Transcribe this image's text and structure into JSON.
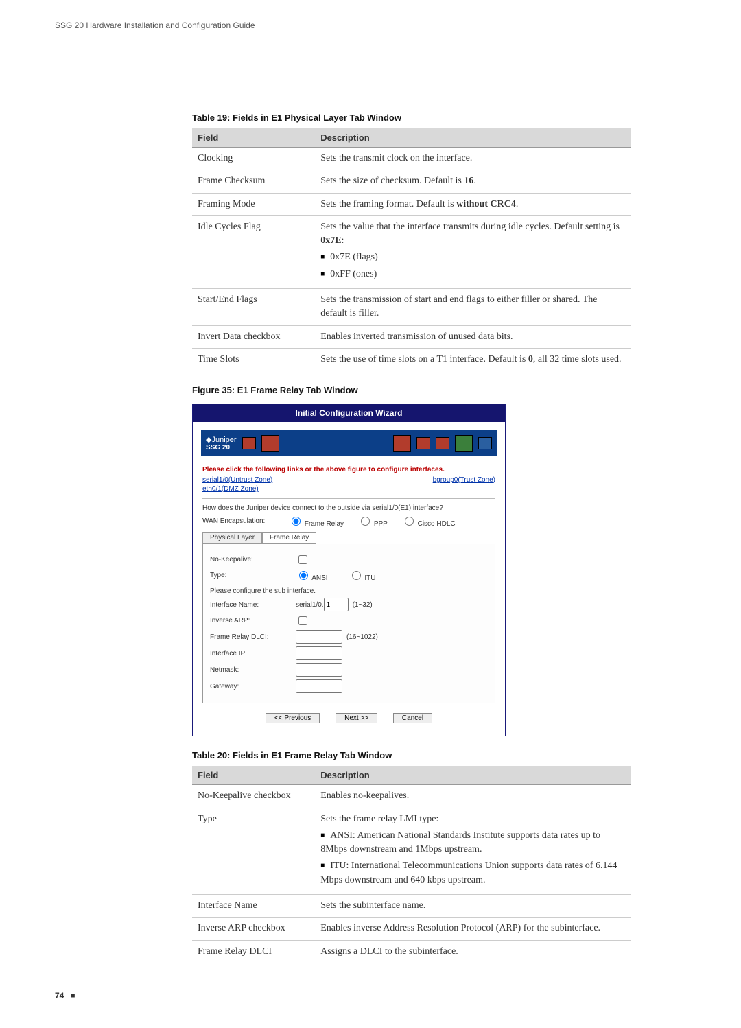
{
  "header": "SSG 20 Hardware Installation and Configuration Guide",
  "page_number": "74",
  "table19": {
    "caption": "Table 19:  Fields in E1 Physical Layer Tab Window",
    "head_field": "Field",
    "head_desc": "Description",
    "r0f": "Clocking",
    "r0d": "Sets the transmit clock on the interface.",
    "r1f": "Frame Checksum",
    "r1d_a": "Sets the size of checksum. Default is ",
    "r1d_b": "16",
    "r1d_c": ".",
    "r2f": "Framing Mode",
    "r2d_a": "Sets the framing format. Default is ",
    "r2d_b": "without CRC4",
    "r2d_c": ".",
    "r3f": "Idle Cycles Flag",
    "r3d_a": "Sets the value that the interface transmits during idle cycles. Default setting is ",
    "r3d_b": "0x7E",
    "r3d_c": ":",
    "r3li1": "0x7E (flags)",
    "r3li2": "0xFF (ones)",
    "r4f": "Start/End Flags",
    "r4d": "Sets the transmission of start and end flags to either filler or shared. The default is filler.",
    "r5f": "Invert Data checkbox",
    "r5d": "Enables inverted transmission of unused data bits.",
    "r6f": "Time Slots",
    "r6d_a": "Sets the use of time slots on a T1 interface. Default is ",
    "r6d_b": "0",
    "r6d_c": ", all 32 time slots used."
  },
  "figure35": {
    "caption": "Figure 35:  E1 Frame Relay Tab Window",
    "wizard_title": "Initial Configuration Wizard",
    "brand": "Juniper",
    "product": "SSG 20",
    "instruction": "Please click the following links or the above figure to configure interfaces.",
    "link1": "serial1/0(Untrust Zone)",
    "link2": "bgroup0(Trust Zone)",
    "link3": "eth0/1(DMZ Zone)",
    "question": "How does the Juniper device connect to the outside via serial1/0(E1) interface?",
    "wanEncapLabel": "WAN Encapsulation:",
    "optFR": "Frame Relay",
    "optPPP": "PPP",
    "optHDLC": "Cisco HDLC",
    "tab1": "Physical Layer",
    "tab2": "Frame Relay",
    "noKeepaliveLabel": "No-Keepalive:",
    "typeLabel": "Type:",
    "optANSI": "ANSI",
    "optITU": "ITU",
    "subifNote": "Please configure the sub interface.",
    "ifNameLabel": "Interface Name:",
    "ifNamePrefix": "serial1/0.",
    "ifNameVal": "1",
    "ifNameRange": "(1~32)",
    "invArpLabel": "Inverse ARP:",
    "dlciLabel": "Frame Relay DLCI:",
    "dlciRange": "(16~1022)",
    "ifIpLabel": "Interface IP:",
    "netmaskLabel": "Netmask:",
    "gatewayLabel": "Gateway:",
    "btnPrev": "<< Previous",
    "btnNext": "Next >>",
    "btnCancel": "Cancel"
  },
  "table20": {
    "caption": "Table 20:  Fields in E1 Frame Relay Tab Window",
    "head_field": "Field",
    "head_desc": "Description",
    "r0f": "No-Keepalive checkbox",
    "r0d": "Enables no-keepalives.",
    "r1f": "Type",
    "r1d": "Sets the frame relay LMI type:",
    "r1li1": "ANSI: American National Standards Institute supports data rates up to 8Mbps downstream and 1Mbps upstream.",
    "r1li2": "ITU: International Telecommunications Union supports data rates of 6.144 Mbps downstream and 640 kbps upstream.",
    "r2f": "Interface Name",
    "r2d": "Sets the subinterface name.",
    "r3f": "Inverse ARP checkbox",
    "r3d": "Enables inverse Address Resolution Protocol (ARP) for the subinterface.",
    "r4f": "Frame Relay DLCI",
    "r4d": "Assigns a DLCI to the subinterface."
  }
}
